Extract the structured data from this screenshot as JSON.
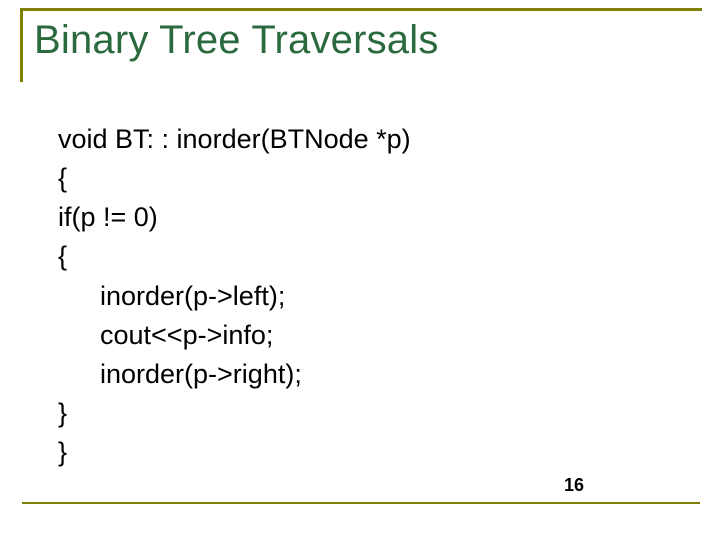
{
  "slide": {
    "title": "Binary Tree Traversals",
    "code": {
      "l1": "void BT: : inorder(BTNode *p)",
      "l2": "{",
      "l3": "if(p != 0)",
      "l4": "{",
      "l5": "inorder(p->left);",
      "l6": "cout<<p->info;",
      "l7": "inorder(p->right);",
      "l8": "}",
      "l9": "}"
    },
    "page_number": "16"
  }
}
